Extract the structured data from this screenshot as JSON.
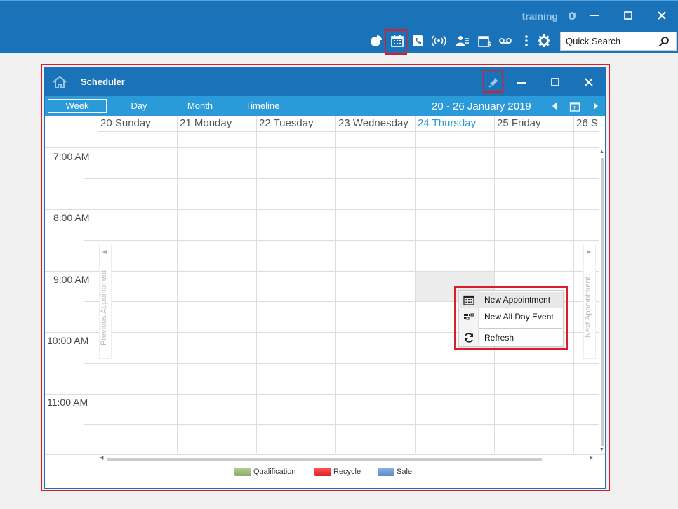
{
  "app": {
    "user": "training",
    "search_placeholder": "Quick Search",
    "toolbar_icons": [
      "dashboard-pie-icon",
      "calendar-icon",
      "phone-icon",
      "broadcast-icon",
      "contacts-icon",
      "billing-calendar-icon",
      "voicemail-icon",
      "more-vertical-icon",
      "gear-icon"
    ]
  },
  "scheduler": {
    "title": "Scheduler",
    "tabs": [
      "Week",
      "Day",
      "Month",
      "Timeline"
    ],
    "active_tab": "Week",
    "date_range": "20  - 26 January 2019",
    "days": [
      "20 Sunday",
      "21 Monday",
      "22 Tuesday",
      "23 Wednesday",
      "24 Thursday",
      "25 Friday",
      "26 S"
    ],
    "today": "24 Thursday",
    "times": [
      "7:00 AM",
      "8:00 AM",
      "9:00 AM",
      "10:00 AM",
      "11:00 AM"
    ],
    "prev_label": "Previous Appointment",
    "next_label": "Next Appointment",
    "legend": [
      {
        "label": "Qualification",
        "color": "#8faa6a"
      },
      {
        "label": "Recycle",
        "color": "#e02020"
      },
      {
        "label": "Sale",
        "color": "#5b8bc8"
      }
    ]
  },
  "context_menu": {
    "items": [
      "New Appointment",
      "New All Day Event",
      "Refresh"
    ]
  },
  "colors": {
    "primary": "#1a73b8",
    "nav": "#2a9ad8",
    "highlight": "#d81e2a"
  }
}
